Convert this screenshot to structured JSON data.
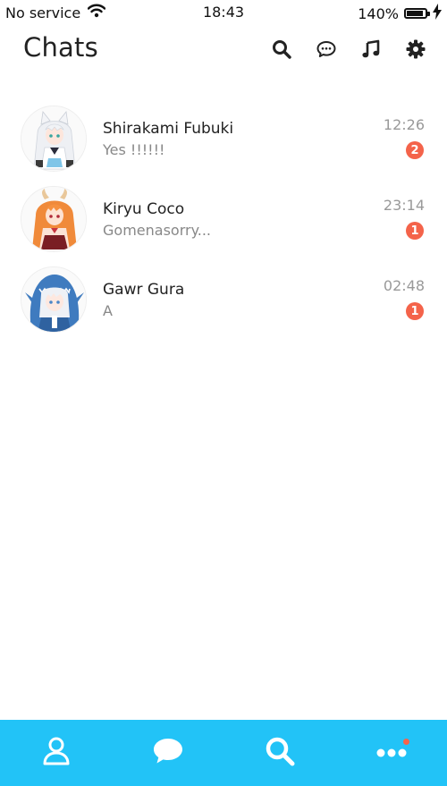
{
  "status_bar": {
    "carrier": "No service",
    "time": "18:43",
    "battery_percent": "140%",
    "battery_level": 0.9,
    "wifi_icon": "wifi-icon",
    "charging_icon": "bolt-icon"
  },
  "header": {
    "title": "Chats",
    "icons": [
      "search-icon",
      "chat-bubble-icon",
      "music-note-icon",
      "gear-icon"
    ]
  },
  "chats": [
    {
      "name": "Shirakami Fubuki",
      "last_message": "Yes !!!!!!",
      "time": "12:26",
      "unread": "2",
      "avatar": "fubuki-avatar"
    },
    {
      "name": "Kiryu Coco",
      "last_message": "Gomenasorry...",
      "time": "23:14",
      "unread": "1",
      "avatar": "coco-avatar"
    },
    {
      "name": "Gawr Gura",
      "last_message": "A",
      "time": "02:48",
      "unread": "1",
      "avatar": "gura-avatar"
    }
  ],
  "tabbar": {
    "tabs": [
      "contacts-icon",
      "chats-icon",
      "search-icon",
      "more-icon"
    ],
    "more_has_notification": true
  },
  "colors": {
    "accent": "#22c3f7",
    "badge": "#f4634a"
  }
}
